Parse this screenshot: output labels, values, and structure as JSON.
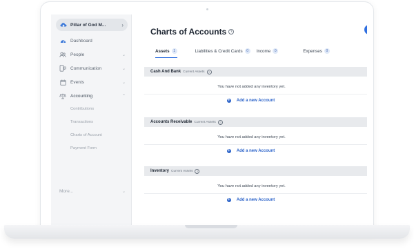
{
  "sidebar": {
    "org_name": "Pillar of God M...",
    "items": [
      {
        "label": "Dashboard"
      },
      {
        "label": "People"
      },
      {
        "label": "Communication"
      },
      {
        "label": "Events"
      },
      {
        "label": "Accounting"
      }
    ],
    "accounting_subitems": [
      {
        "label": "Contributions"
      },
      {
        "label": "Transactions"
      },
      {
        "label": "Charts of Account"
      },
      {
        "label": "Payment Form"
      }
    ],
    "more_label": "More..."
  },
  "main": {
    "title": "Charts of Accounts",
    "tabs": [
      {
        "label": "Assets",
        "count": "1"
      },
      {
        "label": "Liabilities & Credit Cards",
        "count": "0"
      },
      {
        "label": "Income",
        "count": "0"
      },
      {
        "label": "Expenses",
        "count": "0"
      }
    ],
    "sections": [
      {
        "title": "Cash And Bank",
        "subtitle": "Current Assets",
        "empty_message": "You have not added any inventory yet.",
        "add_label": "Add a new Account"
      },
      {
        "title": "Accounts Receivable",
        "subtitle": "Current Assets",
        "empty_message": "You have not added any inventory yet.",
        "add_label": "Add a new Account"
      },
      {
        "title": "Inventory",
        "subtitle": "Current Assets",
        "empty_message": "You have not added any inventory yet.",
        "add_label": "Add a new Account"
      }
    ]
  },
  "colors": {
    "accent": "#2f6fe0",
    "link": "#2a62c9",
    "sidebar_bg": "#f4f5f7",
    "section_header_bg": "#e8eaed"
  },
  "icons": {
    "org": "cloud-church-icon",
    "dashboard": "dashboard-icon",
    "people": "people-icon",
    "communication": "communication-icon",
    "events": "calendar-icon",
    "accounting": "accounting-scale-icon",
    "add": "plus-circle-icon",
    "help": "help-circle-icon"
  }
}
